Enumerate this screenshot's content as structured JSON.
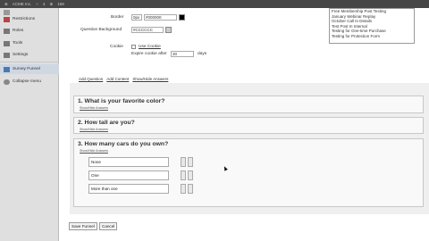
{
  "topbar": {
    "site_name": "ACME Inc.",
    "comments_count": "4",
    "updates_count": "156"
  },
  "sidebar": {
    "items": [
      {
        "label": "Restrictions"
      },
      {
        "label": "Roles"
      },
      {
        "label": "Tools"
      },
      {
        "label": "Settings"
      },
      {
        "label": "Survey Funnel"
      },
      {
        "label": "Collapse menu"
      }
    ]
  },
  "settings": {
    "border_label": "Border",
    "border_width": "0px",
    "border_color": "#000000",
    "question_bg_label": "Question Background",
    "question_bg_value": "#CCCCCC",
    "cookie_label": "Cookie",
    "use_cookie_label": "Use Cookie",
    "expire_label": "Expire cookie after",
    "expire_value": "30",
    "expire_unit": "days"
  },
  "colors": {
    "border_swatch": "#000000",
    "bg_swatch": "#CCCCCC"
  },
  "listbox": {
    "items": [
      "Free Membership Post Testing",
      "January Webinar Replay",
      "October Call In Details",
      "Test Post In Internal",
      "Testing for One-time Purchase",
      "Testing for Protection Form"
    ]
  },
  "toolbar": {
    "add_question": "Add Question",
    "add_content": "Add Content",
    "show_hide": "Show/Hide Answers"
  },
  "questions": [
    {
      "title": "1.  What is your favorite color?",
      "sub": "Show/Hide Answers"
    },
    {
      "title": "2.  How tall are you?",
      "sub": "Show/Hide Answers"
    },
    {
      "title": "3.  How many cars do you own?",
      "sub": "Show/Hide Answers",
      "answers": [
        "None",
        "One",
        "More than one"
      ]
    }
  ],
  "buttons": {
    "save": "Save Funnel",
    "cancel": "Cancel"
  }
}
